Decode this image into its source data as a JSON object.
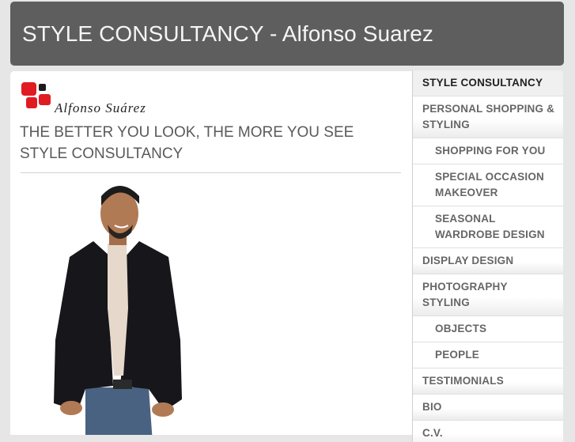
{
  "site": {
    "title": "STYLE CONSULTANCY - Alfonso Suarez"
  },
  "logo": {
    "signature": "Alfonso Suárez",
    "brand_color": "#e01b22",
    "secondary_color": "#1a1a1a"
  },
  "content": {
    "tagline_line1": "THE BETTER YOU LOOK, THE MORE YOU SEE",
    "tagline_line2": "STYLE CONSULTANCY"
  },
  "nav": {
    "items": [
      {
        "label": "STYLE CONSULTANCY",
        "level": 0,
        "active": true
      },
      {
        "label": "PERSONAL SHOPPING & STYLING",
        "level": 0,
        "active": false
      },
      {
        "label": "SHOPPING FOR YOU",
        "level": 1,
        "active": false
      },
      {
        "label": "SPECIAL OCCASION MAKEOVER",
        "level": 1,
        "active": false
      },
      {
        "label": "SEASONAL WARDROBE DESIGN",
        "level": 1,
        "active": false
      },
      {
        "label": "DISPLAY DESIGN",
        "level": 0,
        "active": false
      },
      {
        "label": "PHOTOGRAPHY STYLING",
        "level": 0,
        "active": false
      },
      {
        "label": "OBJECTS",
        "level": 1,
        "active": false
      },
      {
        "label": "PEOPLE",
        "level": 1,
        "active": false
      },
      {
        "label": "TESTIMONIALS",
        "level": 0,
        "active": false
      },
      {
        "label": "BIO",
        "level": 0,
        "active": false
      },
      {
        "label": "C.V.",
        "level": 0,
        "active": false
      }
    ]
  }
}
